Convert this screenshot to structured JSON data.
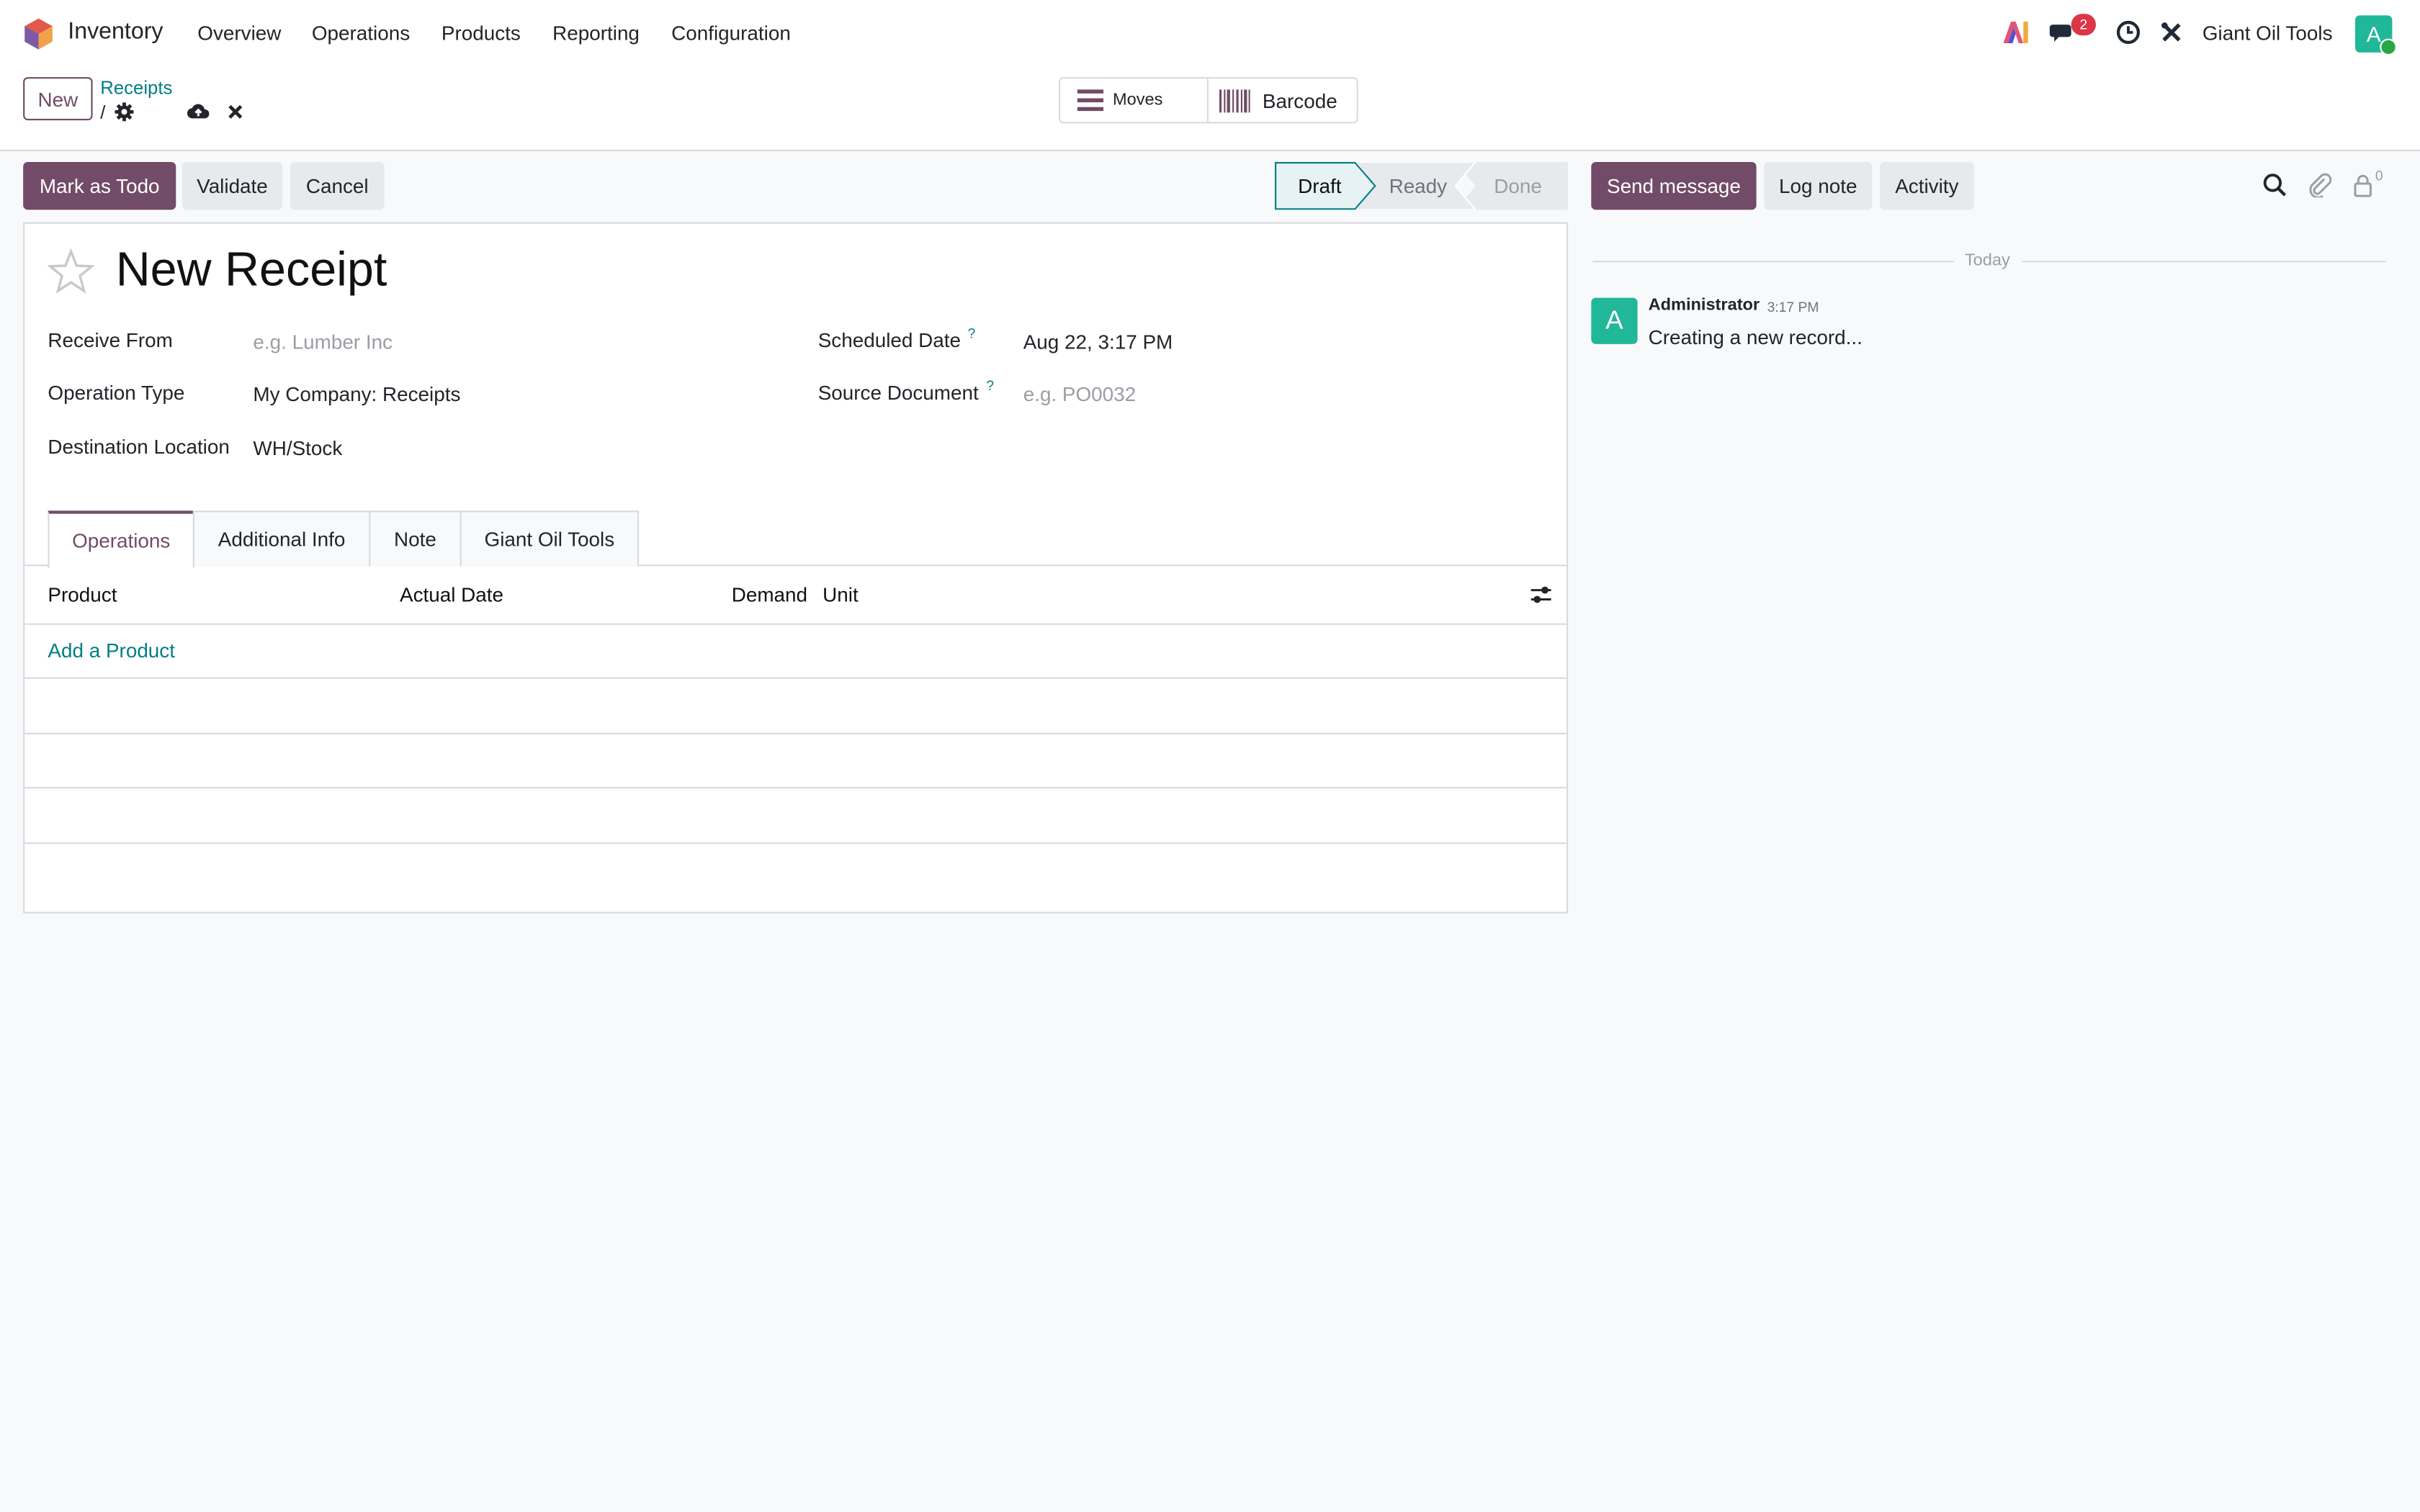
{
  "navbar": {
    "app_name": "Inventory",
    "menu": [
      "Overview",
      "Operations",
      "Products",
      "Reporting",
      "Configuration"
    ],
    "messages_badge": "2",
    "company": "Giant Oil Tools",
    "avatar_letter": "A"
  },
  "control_panel": {
    "new_label": "New",
    "breadcrumb_parent": "Receipts",
    "breadcrumb_sep": "/",
    "smart_buttons": {
      "moves": "Moves",
      "barcode": "Barcode"
    }
  },
  "actions": {
    "mark_todo": "Mark as Todo",
    "validate": "Validate",
    "cancel": "Cancel"
  },
  "statusbar": {
    "stages": [
      "Draft",
      "Ready",
      "Done"
    ],
    "current": "Draft"
  },
  "form": {
    "title": "New Receipt",
    "fields": {
      "receive_from": {
        "label": "Receive From",
        "placeholder": "e.g. Lumber Inc"
      },
      "operation_type": {
        "label": "Operation Type",
        "value": "My Company: Receipts"
      },
      "destination_location": {
        "label": "Destination Location",
        "value": "WH/Stock"
      },
      "scheduled_date": {
        "label": "Scheduled Date",
        "help": "?",
        "value": "Aug 22, 3:17 PM"
      },
      "source_document": {
        "label": "Source Document",
        "help": "?",
        "placeholder": "e.g. PO0032"
      }
    },
    "tabs": [
      "Operations",
      "Additional Info",
      "Note",
      "Giant Oil Tools"
    ],
    "active_tab": "Operations",
    "table": {
      "columns": [
        "Product",
        "Actual Date",
        "Demand",
        "Unit"
      ],
      "add_line": "Add a Product"
    }
  },
  "chatter": {
    "send_message": "Send message",
    "log_note": "Log note",
    "activity": "Activity",
    "followers_count": "0",
    "date_separator": "Today",
    "messages": [
      {
        "avatar": "A",
        "author": "Administrator",
        "time": "3:17 PM",
        "body": "Creating a new record..."
      }
    ]
  },
  "colors": {
    "primary": "#714b67",
    "link": "#017e84",
    "avatar": "#21b799"
  }
}
